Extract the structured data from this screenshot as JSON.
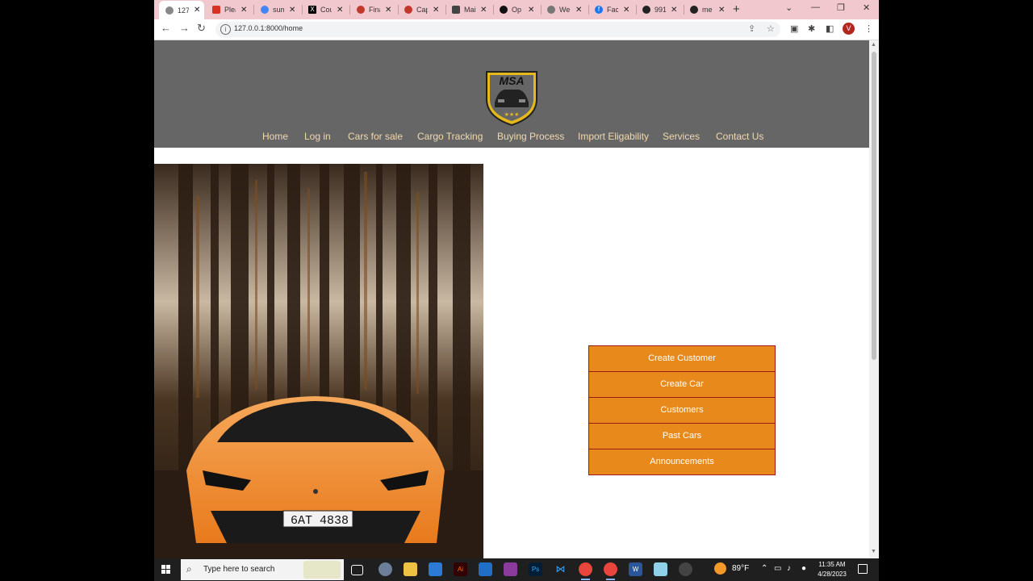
{
  "browser": {
    "tabs": [
      {
        "title": "127",
        "icon": "globe-icon",
        "active": true
      },
      {
        "title": "Plea",
        "icon": "gmail-icon"
      },
      {
        "title": "sum",
        "icon": "google-icon"
      },
      {
        "title": "Cou",
        "icon": "x-icon"
      },
      {
        "title": "Fina",
        "icon": "shield-icon"
      },
      {
        "title": "Cap",
        "icon": "shield-icon"
      },
      {
        "title": "Mai",
        "icon": "mail-icon"
      },
      {
        "title": "Op",
        "icon": "openai-icon"
      },
      {
        "title": "We",
        "icon": "globe-icon"
      },
      {
        "title": "Fac",
        "icon": "facebook-icon"
      },
      {
        "title": "991",
        "icon": "github-icon"
      },
      {
        "title": "me",
        "icon": "github-icon"
      }
    ],
    "url": "127.0.0.1:8000/home",
    "profile_initial": "V"
  },
  "site": {
    "logo_text": "MSA",
    "nav": [
      "Home",
      "Log in",
      "Cars for sale",
      "Cargo Tracking",
      "Buying Process",
      "Import Eligability",
      "Services",
      "Contact Us"
    ],
    "admin_menu": [
      "Create Customer",
      "Create Car",
      "Customers",
      "Past Cars",
      "Announcements"
    ],
    "hero_plate": "6AT 4838"
  },
  "taskbar": {
    "search_placeholder": "Type here to search",
    "weather": "89°F",
    "time": "11:35 AM",
    "date": "4/28/2023"
  },
  "colors": {
    "header_bg": "#666666",
    "nav_text": "#f1d9ae",
    "menu_button": "#e8891b",
    "menu_border": "#a01818",
    "logo_gold": "#e5b81c",
    "tabstrip": "#f2c8cf"
  }
}
